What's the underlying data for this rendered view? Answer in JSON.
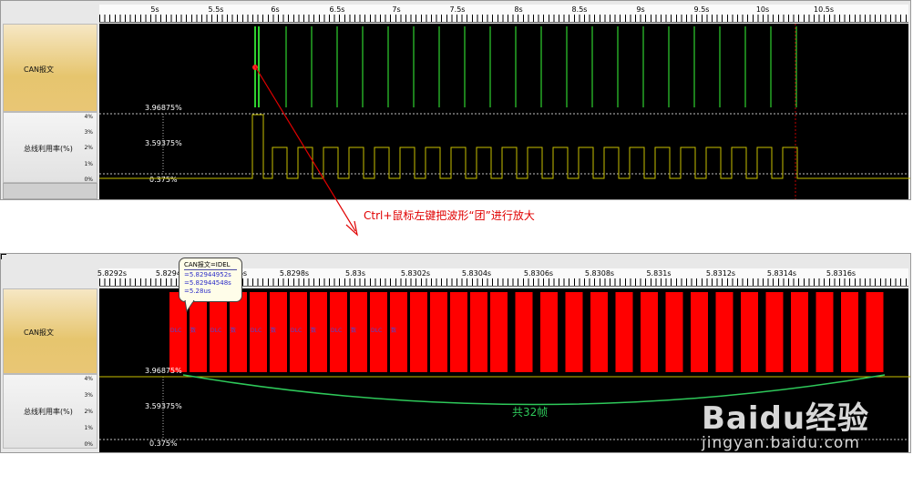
{
  "top": {
    "ruler_ticks": [
      "5s",
      "5.5s",
      "6s",
      "6.5s",
      "7s",
      "7.5s",
      "8s",
      "8.5s",
      "9s",
      "9.5s",
      "10s",
      "10.5s"
    ],
    "channel_label": "CAN报文",
    "bus_label": "总线利用率(%)",
    "axis_pcts": [
      "4%",
      "3%",
      "2%",
      "1%",
      "0%"
    ],
    "level_high": "3.96875%",
    "level_mid": "3.59375%",
    "level_low": "0.375%",
    "colors": {
      "signal": "#2fd12f",
      "utilization": "#c8c000",
      "cursor": "#ff3030",
      "pulse": "#ff0000"
    }
  },
  "annotation": {
    "text": "Ctrl+鼠标左键把波形“团”进行放大"
  },
  "bottom": {
    "ruler_ticks": [
      "5.8292s",
      "5.8294s",
      "5.8296s",
      "5.8298s",
      "5.83s",
      "5.8302s",
      "5.8304s",
      "5.8306s",
      "5.8308s",
      "5.831s",
      "5.8312s",
      "5.8314s",
      "5.8316s"
    ],
    "channel_label": "CAN报文",
    "bus_label": "总线利用率(%)",
    "axis_pcts": [
      "4%",
      "3%",
      "2%",
      "1%",
      "0%"
    ],
    "level_high": "3.96875%",
    "level_mid": "3.59375%",
    "level_low": "0.375%",
    "frame_text": "DLC",
    "frame_text_alt": "数",
    "frame_count_label": "共32帧",
    "tooltip": {
      "title": "CAN报文=IDEL",
      "values": [
        "=5.82944952s",
        "=5.82944548s",
        "=5.28us"
      ]
    }
  },
  "watermark": {
    "brand": "Baidu经验",
    "url": "jingyan.baidu.com"
  }
}
